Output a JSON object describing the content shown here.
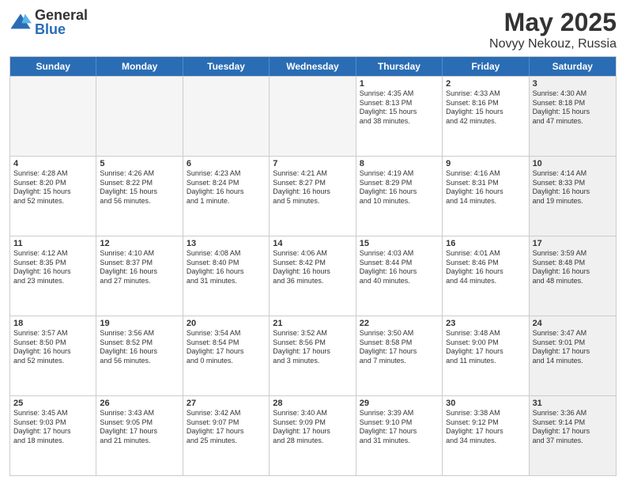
{
  "logo": {
    "general": "General",
    "blue": "Blue"
  },
  "title": "May 2025",
  "subtitle": "Novyy Nekouz, Russia",
  "header_days": [
    "Sunday",
    "Monday",
    "Tuesday",
    "Wednesday",
    "Thursday",
    "Friday",
    "Saturday"
  ],
  "rows": [
    [
      {
        "day": "",
        "text": "",
        "empty": true
      },
      {
        "day": "",
        "text": "",
        "empty": true
      },
      {
        "day": "",
        "text": "",
        "empty": true
      },
      {
        "day": "",
        "text": "",
        "empty": true
      },
      {
        "day": "1",
        "text": "Sunrise: 4:35 AM\nSunset: 8:13 PM\nDaylight: 15 hours\nand 38 minutes.",
        "empty": false
      },
      {
        "day": "2",
        "text": "Sunrise: 4:33 AM\nSunset: 8:16 PM\nDaylight: 15 hours\nand 42 minutes.",
        "empty": false
      },
      {
        "day": "3",
        "text": "Sunrise: 4:30 AM\nSunset: 8:18 PM\nDaylight: 15 hours\nand 47 minutes.",
        "empty": false,
        "shaded": true
      }
    ],
    [
      {
        "day": "4",
        "text": "Sunrise: 4:28 AM\nSunset: 8:20 PM\nDaylight: 15 hours\nand 52 minutes.",
        "empty": false
      },
      {
        "day": "5",
        "text": "Sunrise: 4:26 AM\nSunset: 8:22 PM\nDaylight: 15 hours\nand 56 minutes.",
        "empty": false
      },
      {
        "day": "6",
        "text": "Sunrise: 4:23 AM\nSunset: 8:24 PM\nDaylight: 16 hours\nand 1 minute.",
        "empty": false
      },
      {
        "day": "7",
        "text": "Sunrise: 4:21 AM\nSunset: 8:27 PM\nDaylight: 16 hours\nand 5 minutes.",
        "empty": false
      },
      {
        "day": "8",
        "text": "Sunrise: 4:19 AM\nSunset: 8:29 PM\nDaylight: 16 hours\nand 10 minutes.",
        "empty": false
      },
      {
        "day": "9",
        "text": "Sunrise: 4:16 AM\nSunset: 8:31 PM\nDaylight: 16 hours\nand 14 minutes.",
        "empty": false
      },
      {
        "day": "10",
        "text": "Sunrise: 4:14 AM\nSunset: 8:33 PM\nDaylight: 16 hours\nand 19 minutes.",
        "empty": false,
        "shaded": true
      }
    ],
    [
      {
        "day": "11",
        "text": "Sunrise: 4:12 AM\nSunset: 8:35 PM\nDaylight: 16 hours\nand 23 minutes.",
        "empty": false
      },
      {
        "day": "12",
        "text": "Sunrise: 4:10 AM\nSunset: 8:37 PM\nDaylight: 16 hours\nand 27 minutes.",
        "empty": false
      },
      {
        "day": "13",
        "text": "Sunrise: 4:08 AM\nSunset: 8:40 PM\nDaylight: 16 hours\nand 31 minutes.",
        "empty": false
      },
      {
        "day": "14",
        "text": "Sunrise: 4:06 AM\nSunset: 8:42 PM\nDaylight: 16 hours\nand 36 minutes.",
        "empty": false
      },
      {
        "day": "15",
        "text": "Sunrise: 4:03 AM\nSunset: 8:44 PM\nDaylight: 16 hours\nand 40 minutes.",
        "empty": false
      },
      {
        "day": "16",
        "text": "Sunrise: 4:01 AM\nSunset: 8:46 PM\nDaylight: 16 hours\nand 44 minutes.",
        "empty": false
      },
      {
        "day": "17",
        "text": "Sunrise: 3:59 AM\nSunset: 8:48 PM\nDaylight: 16 hours\nand 48 minutes.",
        "empty": false,
        "shaded": true
      }
    ],
    [
      {
        "day": "18",
        "text": "Sunrise: 3:57 AM\nSunset: 8:50 PM\nDaylight: 16 hours\nand 52 minutes.",
        "empty": false
      },
      {
        "day": "19",
        "text": "Sunrise: 3:56 AM\nSunset: 8:52 PM\nDaylight: 16 hours\nand 56 minutes.",
        "empty": false
      },
      {
        "day": "20",
        "text": "Sunrise: 3:54 AM\nSunset: 8:54 PM\nDaylight: 17 hours\nand 0 minutes.",
        "empty": false
      },
      {
        "day": "21",
        "text": "Sunrise: 3:52 AM\nSunset: 8:56 PM\nDaylight: 17 hours\nand 3 minutes.",
        "empty": false
      },
      {
        "day": "22",
        "text": "Sunrise: 3:50 AM\nSunset: 8:58 PM\nDaylight: 17 hours\nand 7 minutes.",
        "empty": false
      },
      {
        "day": "23",
        "text": "Sunrise: 3:48 AM\nSunset: 9:00 PM\nDaylight: 17 hours\nand 11 minutes.",
        "empty": false
      },
      {
        "day": "24",
        "text": "Sunrise: 3:47 AM\nSunset: 9:01 PM\nDaylight: 17 hours\nand 14 minutes.",
        "empty": false,
        "shaded": true
      }
    ],
    [
      {
        "day": "25",
        "text": "Sunrise: 3:45 AM\nSunset: 9:03 PM\nDaylight: 17 hours\nand 18 minutes.",
        "empty": false
      },
      {
        "day": "26",
        "text": "Sunrise: 3:43 AM\nSunset: 9:05 PM\nDaylight: 17 hours\nand 21 minutes.",
        "empty": false
      },
      {
        "day": "27",
        "text": "Sunrise: 3:42 AM\nSunset: 9:07 PM\nDaylight: 17 hours\nand 25 minutes.",
        "empty": false
      },
      {
        "day": "28",
        "text": "Sunrise: 3:40 AM\nSunset: 9:09 PM\nDaylight: 17 hours\nand 28 minutes.",
        "empty": false
      },
      {
        "day": "29",
        "text": "Sunrise: 3:39 AM\nSunset: 9:10 PM\nDaylight: 17 hours\nand 31 minutes.",
        "empty": false
      },
      {
        "day": "30",
        "text": "Sunrise: 3:38 AM\nSunset: 9:12 PM\nDaylight: 17 hours\nand 34 minutes.",
        "empty": false
      },
      {
        "day": "31",
        "text": "Sunrise: 3:36 AM\nSunset: 9:14 PM\nDaylight: 17 hours\nand 37 minutes.",
        "empty": false,
        "shaded": true
      }
    ]
  ]
}
